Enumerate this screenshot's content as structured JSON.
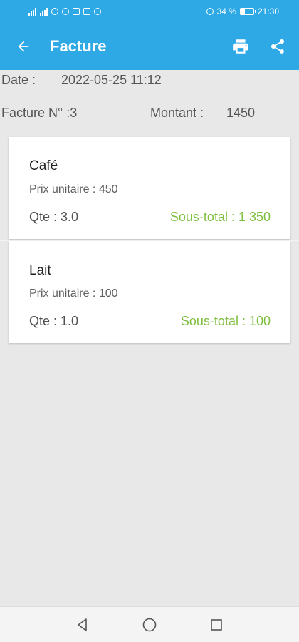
{
  "status_bar": {
    "battery": "34 %",
    "time": "21:30",
    "battery_level": 0.34
  },
  "app_bar": {
    "title": "Facture",
    "back_icon": "arrow-left-icon",
    "print_icon": "printer-icon",
    "share_icon": "share-icon"
  },
  "invoice": {
    "date_label": "Date :",
    "date_value": "2022-05-25 11:12",
    "number_label": "Facture N° :3",
    "amount_label": "Montant :",
    "amount_value": "1450"
  },
  "items": [
    {
      "name": "Café",
      "unit_price": "Prix unitaire : 450",
      "quantity": "Qte : 3.0",
      "subtotal": "Sous-total : 1 350"
    },
    {
      "name": "Lait",
      "unit_price": "Prix unitaire : 100",
      "quantity": "Qte : 1.0",
      "subtotal": "Sous-total : 100"
    }
  ],
  "colors": {
    "primary": "#2ea9e6",
    "subtotal": "#7fbf3f",
    "background": "#e8e8e8"
  },
  "nav_bar": {
    "back_icon": "triangle-back-icon",
    "home_icon": "circle-home-icon",
    "recents_icon": "square-recents-icon"
  }
}
